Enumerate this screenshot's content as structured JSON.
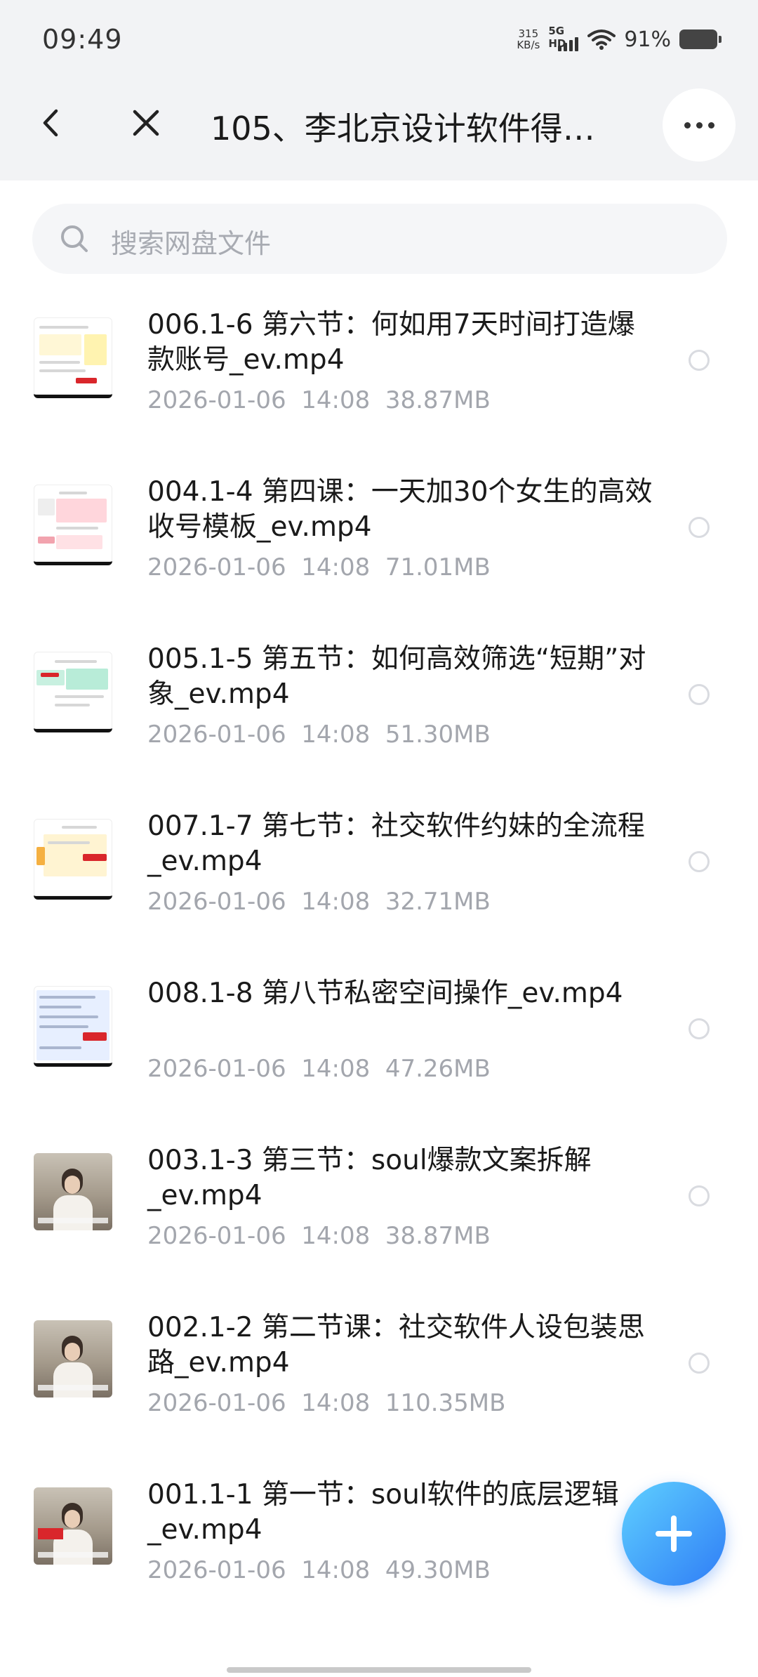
{
  "status_bar": {
    "time": "09:49",
    "net_speed_value": "315",
    "net_speed_unit": "KB/s",
    "signal_label": "5G HD",
    "battery_percent": "91%"
  },
  "header": {
    "title": "105、李北京设计软件得…"
  },
  "search": {
    "placeholder": "搜索网盘文件"
  },
  "files": [
    {
      "name": "006.1-6 第六节：何如用7天时间打造爆款账号_ev.mp4",
      "date": "2026-01-06",
      "time": "14:08",
      "size": "38.87MB",
      "thumb": "doc-yellow"
    },
    {
      "name": "004.1-4 第四课：一天加30个女生的高效收号模板_ev.mp4",
      "date": "2026-01-06",
      "time": "14:08",
      "size": "71.01MB",
      "thumb": "doc-pink"
    },
    {
      "name": "005.1-5 第五节：如何高效筛选“短期”对象_ev.mp4",
      "date": "2026-01-06",
      "time": "14:08",
      "size": "51.30MB",
      "thumb": "doc-green"
    },
    {
      "name": "007.1-7 第七节：社交软件约妹的全流程_ev.mp4",
      "date": "2026-01-06",
      "time": "14:08",
      "size": "32.71MB",
      "thumb": "doc-orange"
    },
    {
      "name": "008.1-8 第八节私密空间操作_ev.mp4",
      "date": "2026-01-06",
      "time": "14:08",
      "size": "47.26MB",
      "thumb": "doc-blue"
    },
    {
      "name": "003.1-3 第三节：soul爆款文案拆解_ev.mp4",
      "date": "2026-01-06",
      "time": "14:08",
      "size": "38.87MB",
      "thumb": "photo"
    },
    {
      "name": "002.1-2 第二节课：社交软件人设包装思路_ev.mp4",
      "date": "2026-01-06",
      "time": "14:08",
      "size": "110.35MB",
      "thumb": "photo"
    },
    {
      "name": "001.1-1 第一节：soul软件的底层逻辑_ev.mp4",
      "date": "2026-01-06",
      "time": "14:08",
      "size": "49.30MB",
      "thumb": "photo"
    }
  ],
  "colors": {
    "accent": "#2f7df6",
    "header_bg": "#f2f3f5",
    "meta_text": "#a3a6ad"
  },
  "icons": {
    "back": "chevron-left-icon",
    "close": "close-icon",
    "more": "more-horizontal-icon",
    "search": "search-icon",
    "fab": "plus-icon",
    "select": "radio-circle-icon"
  }
}
